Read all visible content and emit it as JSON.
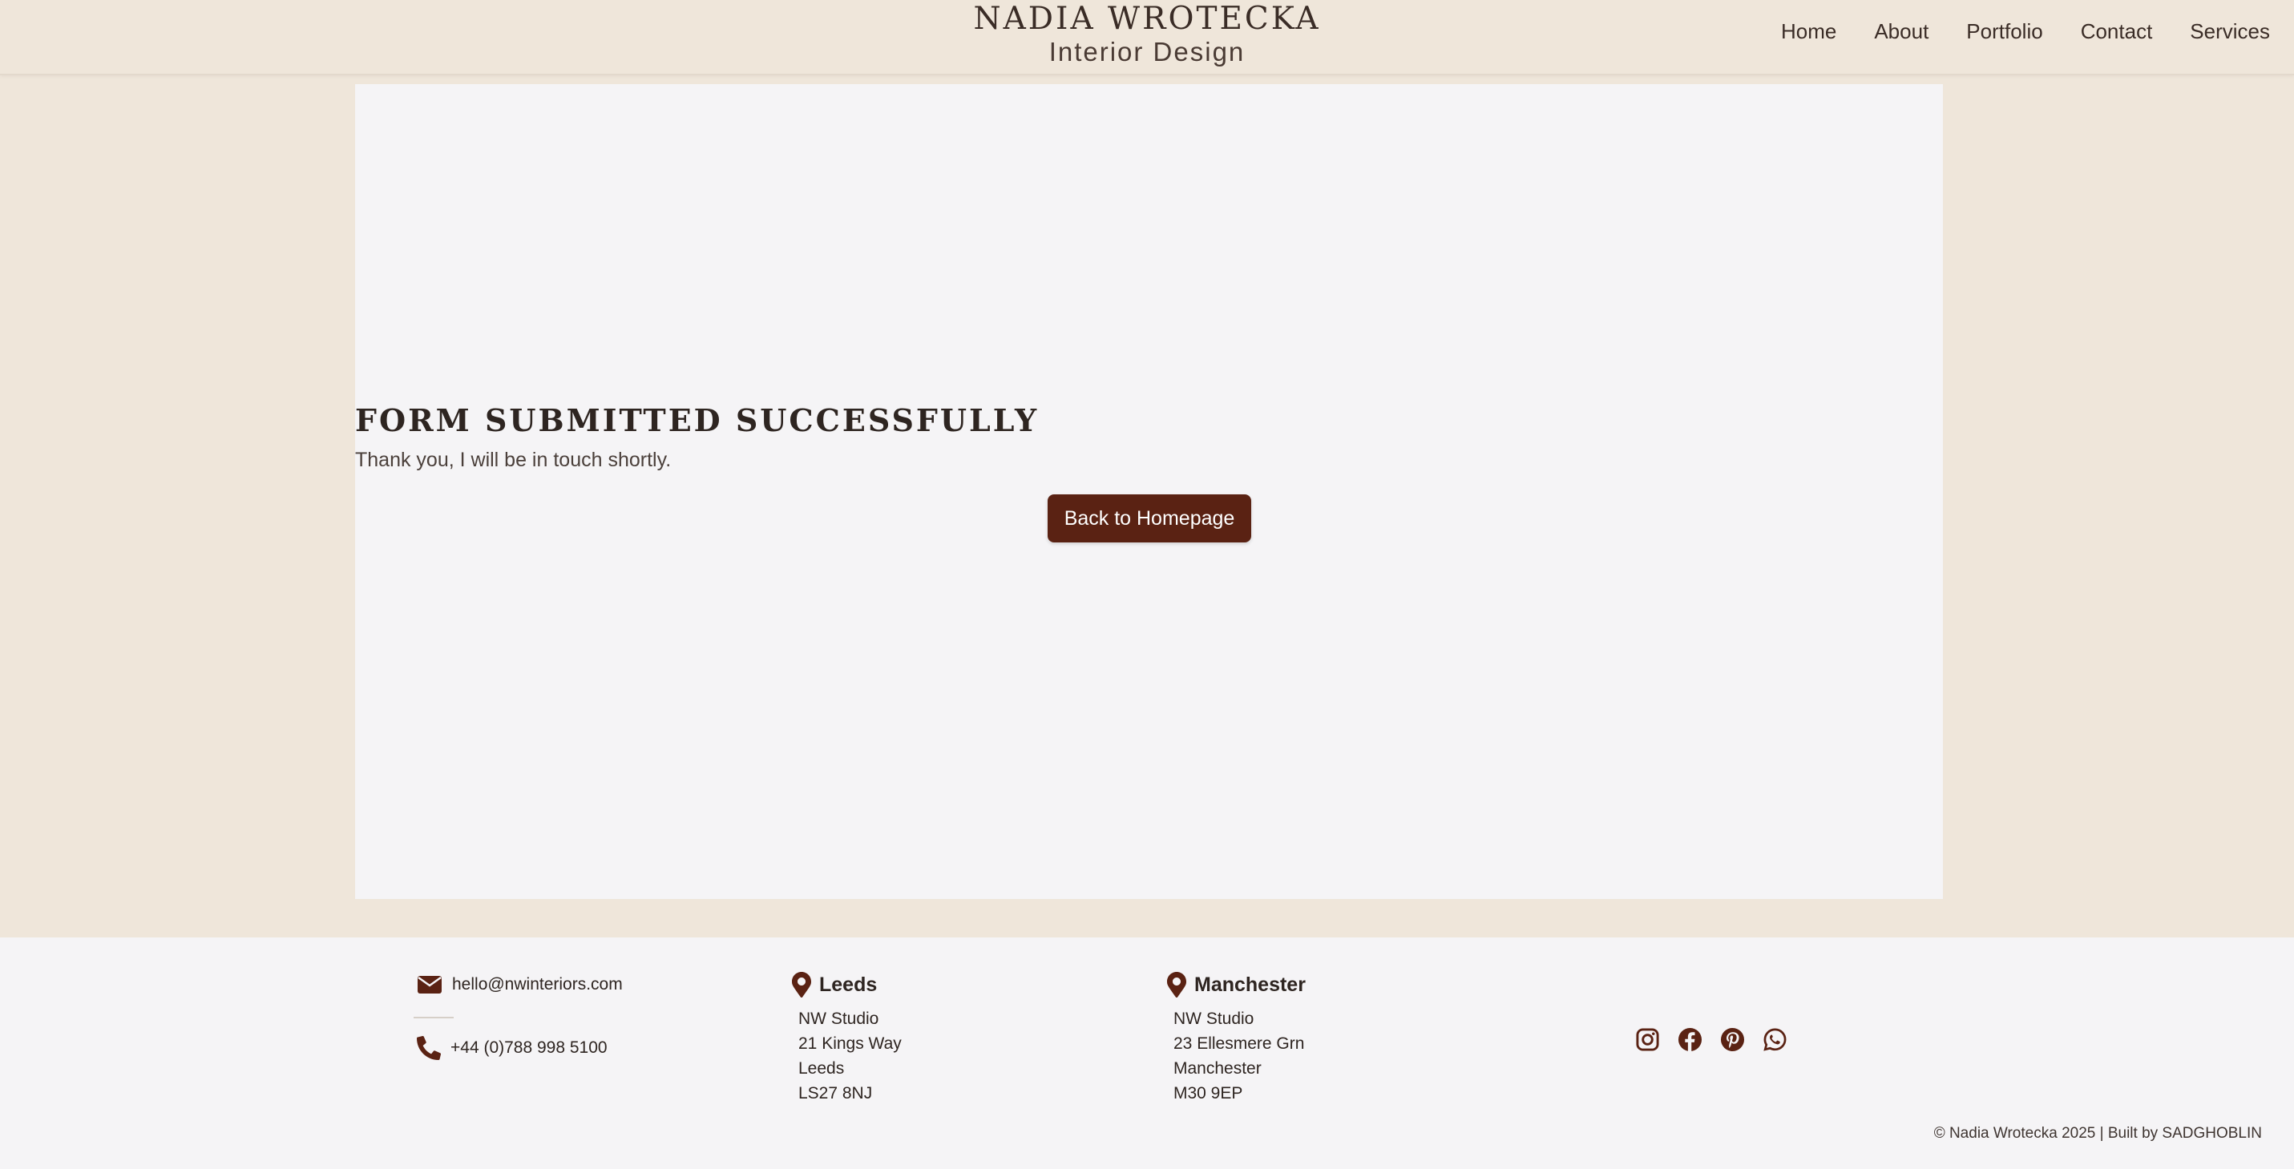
{
  "header": {
    "brand_name": "NADIA WROTECKA",
    "brand_sub": "Interior Design",
    "nav": [
      "Home",
      "About",
      "Portfolio",
      "Contact",
      "Services"
    ]
  },
  "main": {
    "title": "FORM SUBMITTED SUCCESSFULLY",
    "message": "Thank you, I will be in touch shortly.",
    "button_label": "Back to Homepage"
  },
  "footer": {
    "email": "hello@nwinteriors.com",
    "phone": "+44 (0)788 998 5100",
    "locations": [
      {
        "city": "Leeds",
        "lines": [
          "NW Studio",
          "21 Kings Way",
          "Leeds",
          "LS27 8NJ"
        ]
      },
      {
        "city": "Manchester",
        "lines": [
          "NW Studio",
          "23 Ellesmere Grn",
          "Manchester",
          "M30 9EP"
        ]
      }
    ],
    "socials": [
      "instagram-icon",
      "facebook-icon",
      "pinterest-icon",
      "whatsapp-icon"
    ],
    "copyright": "© Nadia Wrotecka 2025  |  Built by SADGHOBLIN"
  },
  "colors": {
    "page_bg": "#efe6da",
    "card_bg": "#f5f4f6",
    "accent": "#5a2213",
    "text": "#2e2521"
  }
}
